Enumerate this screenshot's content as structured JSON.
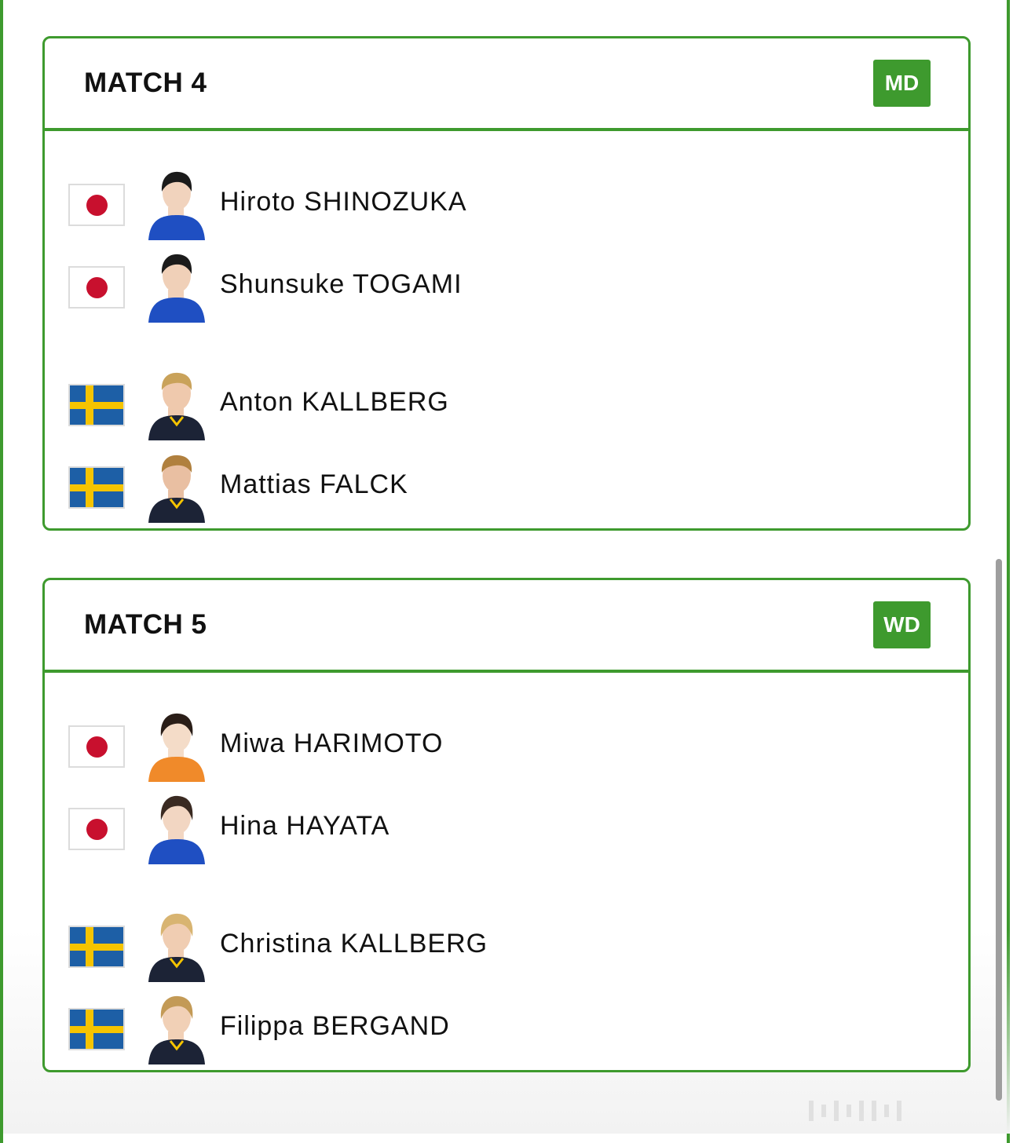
{
  "colors": {
    "accent": "#3e9a2e",
    "japan_red": "#c8102e",
    "sweden_blue": "#1d5fa6",
    "sweden_yellow": "#f5c400"
  },
  "matches": [
    {
      "title": "MATCH 4",
      "badge": "MD",
      "players": [
        {
          "name": "Hiroto SHINOZUKA",
          "flag": "japan-flag",
          "shirt": "#1f4fc2",
          "skin": "#f1d3bd",
          "hair": "#1b1b1b"
        },
        {
          "name": "Shunsuke TOGAMI",
          "flag": "japan-flag",
          "shirt": "#1f4fc2",
          "skin": "#f0d0b8",
          "hair": "#1b1b1b"
        },
        {
          "name": "Anton KALLBERG",
          "flag": "sweden-flag",
          "shirt": "#1c2336",
          "skin": "#efc9ad",
          "hair": "#c9a25a"
        },
        {
          "name": "Mattias FALCK",
          "flag": "sweden-flag",
          "shirt": "#1c2336",
          "skin": "#e9bfa2",
          "hair": "#b0803e"
        }
      ]
    },
    {
      "title": "MATCH 5",
      "badge": "WD",
      "players": [
        {
          "name": "Miwa HARIMOTO",
          "flag": "japan-flag",
          "shirt": "#f08a2a",
          "skin": "#f4dcc8",
          "hair": "#2a1e18"
        },
        {
          "name": "Hina HAYATA",
          "flag": "japan-flag",
          "shirt": "#1f4fc2",
          "skin": "#f2d6c2",
          "hair": "#3a2a22"
        },
        {
          "name": "Christina KALLBERG",
          "flag": "sweden-flag",
          "shirt": "#1c2336",
          "skin": "#f0cdb2",
          "hair": "#d8b471"
        },
        {
          "name": "Filippa BERGAND",
          "flag": "sweden-flag",
          "shirt": "#1c2336",
          "skin": "#f1d0b6",
          "hair": "#c39a56"
        }
      ]
    }
  ]
}
